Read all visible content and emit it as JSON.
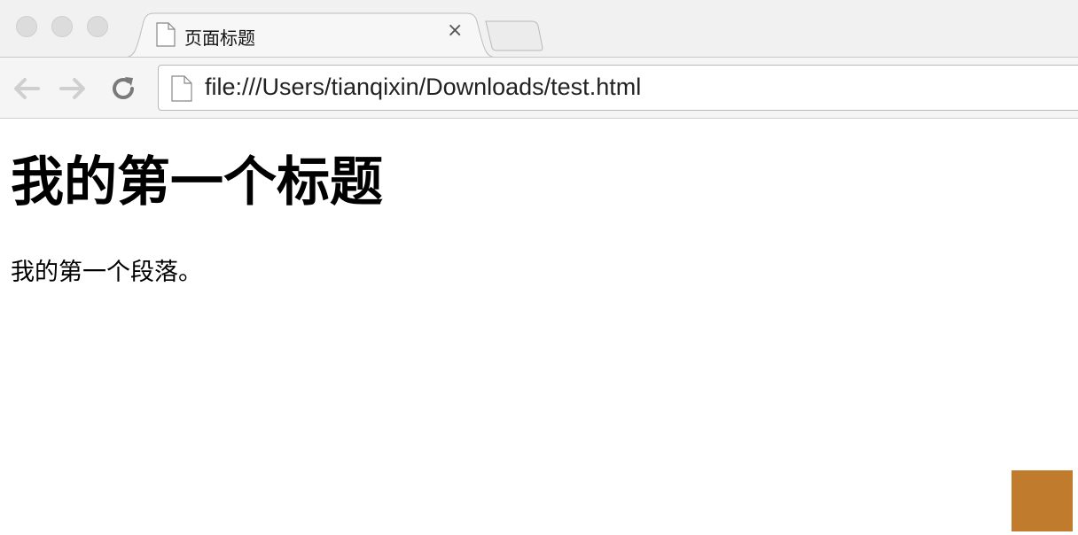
{
  "browser": {
    "tab": {
      "title": "页面标题",
      "close_glyph": "×"
    },
    "address_bar": {
      "url": "file:///Users/tianqixin/Downloads/test.html"
    },
    "icons": [
      "back-arrow-icon",
      "forward-arrow-icon",
      "reload-icon",
      "document-icon",
      "close-icon"
    ]
  },
  "page": {
    "heading": "我的第一个标题",
    "paragraph": "我的第一个段落。"
  },
  "colors": {
    "chrome_bg": "#f1f1f1",
    "toolbar_bg": "#f5f5f5",
    "corner_block": "#c07c2c"
  }
}
